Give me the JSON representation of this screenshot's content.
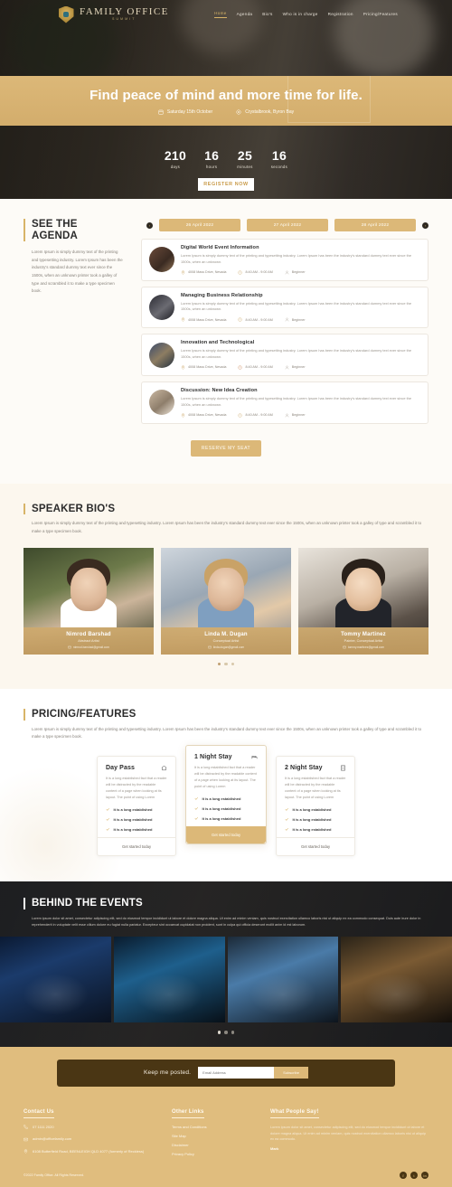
{
  "header": {
    "brand_name": "FAMILY OFFICE",
    "brand_sub": "SUMMIT",
    "nav": [
      {
        "label": "Home",
        "active": true
      },
      {
        "label": "Agenda",
        "active": false
      },
      {
        "label": "Bio's",
        "active": false
      },
      {
        "label": "Who is in charge",
        "active": false
      },
      {
        "label": "Registration",
        "active": false
      },
      {
        "label": "Pricing/Features",
        "active": false
      }
    ]
  },
  "hero": {
    "title": "Find peace of mind and more time for life.",
    "date": "Saturday 15th October",
    "location": "Crystalbrook, Byron Bay",
    "countdown": [
      {
        "value": "210",
        "label": "days"
      },
      {
        "value": "16",
        "label": "hours"
      },
      {
        "value": "25",
        "label": "minutes"
      },
      {
        "value": "16",
        "label": "seconds"
      }
    ],
    "register_label": "REGISTER NOW"
  },
  "agenda": {
    "title": "SEE THE AGENDA",
    "intro": "Lorem Ipsum is simply dummy text of the printing and typesetting industry. Lorem Ipsum has been the industry's standard dummy text ever since the 1500s, when an unknown printer took a galley of type and scrambled it to make a type specimen book.",
    "tabs": [
      "26 April 2022",
      "27 April 2022",
      "28 April 2022"
    ],
    "prev_label": "‹",
    "next_label": "›",
    "sessions": [
      {
        "title": "Digital World Event Information",
        "desc": "Lorem Ipsum is simply dummy text of the printing and typesetting industry. Lorem Ipsum has been the industry's standard dummy text ever since the 1500s, when an unknown.",
        "location": "4008 Mass Drive, Nevada",
        "time": "8:40 AM - 9:00 AM",
        "level": "Beginner"
      },
      {
        "title": "Managing Business Relationship",
        "desc": "Lorem Ipsum is simply dummy text of the printing and typesetting industry. Lorem Ipsum has been the industry's standard dummy text ever since the 1500s, when an unknown.",
        "location": "4008 Mass Drive, Nevada",
        "time": "8:40 AM - 9:00 AM",
        "level": "Beginner"
      },
      {
        "title": "Innovation and Technological",
        "desc": "Lorem Ipsum is simply dummy text of the printing and typesetting industry. Lorem Ipsum has been the industry's standard dummy text ever since the 1500s, when an unknown.",
        "location": "4008 Mass Drive, Nevada",
        "time": "8:40 AM - 9:00 AM",
        "level": "Beginner"
      },
      {
        "title": "Discussion: New Idea Creation",
        "desc": "Lorem Ipsum is simply dummy text of the printing and typesetting industry. Lorem Ipsum has been the industry's standard dummy text ever since the 1500s, when an unknown.",
        "location": "4008 Mass Drive, Nevada",
        "time": "8:40 AM - 9:00 AM",
        "level": "Beginner"
      }
    ],
    "reserve_label": "RESERVE MY SEAT"
  },
  "speakers": {
    "title": "SPEAKER BIO'S",
    "intro": "Lorem Ipsum is simply dummy text of the printing and typesetting industry. Lorem Ipsum has been the industry's standard dummy text ever since the 1500s, when an unknown printer took a galley of type and scrambled it to make a type specimen book.",
    "cards": [
      {
        "name": "Nimrod Barshad",
        "role": "Abstract Artist",
        "email": "nimrod.barshad@gmail.com"
      },
      {
        "name": "Linda M. Dugan",
        "role": "Conceptual Artist",
        "email": "linda.dugan@gmail.com"
      },
      {
        "name": "Tommy Martinez",
        "role": "Painter, Conceptual Artist",
        "email": "tommy.martinez@gmail.com"
      }
    ]
  },
  "pricing": {
    "title": "PRICING/FEATURES",
    "intro": "Lorem Ipsum is simply dummy text of the printing and typesetting industry. Lorem Ipsum has been the industry's standard dummy text ever since the 1500s, when an unknown printer took a galley of type and scrambled it to make a type specimen book.",
    "plans": [
      {
        "title": "Day Pass",
        "icon": "home-icon",
        "desc": "It is a long established fact that a reader will be distracted by the readable content of a page when looking at its layout. The point of using Lorem",
        "features": [
          "It is a long established",
          "It is a long established",
          "It is a long established"
        ],
        "cta": "Get started today",
        "featured": false
      },
      {
        "title": "1 Night Stay",
        "icon": "bed-icon",
        "desc": "It is a long established fact that a reader will be distracted by the readable content of a page when looking at its layout. The point of using Lorem",
        "features": [
          "It is a long established",
          "It is a long established",
          "It is a long established"
        ],
        "cta": "Get started today",
        "featured": true
      },
      {
        "title": "2 Night Stay",
        "icon": "building-icon",
        "desc": "It is a long established fact that a reader will be distracted by the readable content of a page when looking at its layout. The point of using Lorem",
        "features": [
          "It is a long established",
          "It is a long established",
          "It is a long established"
        ],
        "cta": "Get started today",
        "featured": false
      }
    ]
  },
  "behind": {
    "title": "BEHIND THE EVENTS",
    "body": "Lorem ipsum dolor sit amet, consectetur adipiscing elit, sed do eiusmod tempor incididunt ut labore et dolore magna aliqua. Ut enim ad minim veniam, quis nostrud exercitation ullamco laboris nisi ut aliquip ex ea commodo consequat. Duis aute irure dolor in reprehenderit in voluptate velit esse cillum dolore eu fugiat nulla pariatur. Excepteur sint occaecat cupidatat non proident, sunt in culpa qui officia deserunt mollit anim id est laborum."
  },
  "newsletter": {
    "text": "Keep me posted.",
    "placeholder": "Email Address",
    "button": "Subscribe"
  },
  "footer": {
    "contact_title": "Contact Us",
    "phone": "07 1111 2020",
    "email": "admin@officefamily.com",
    "address": "6108 Butterfield Road, BEENLEIGH QLD 4077 (formerly of Reckless)",
    "links_title": "Other Links",
    "links": [
      "Terms and Conditions",
      "Site Map",
      "Disclaimer",
      "Privacy Policy"
    ],
    "quote_title": "What People Say!",
    "quote": "Lorem ipsum dolor sit amet, consectetur adipiscing elit, sed do eiusmod tempor incididunt ut labore et dolore magna aliqua. Ut enim ad minim veniam, quis nostrud exercitation ullamco laboris nisi ut aliquip ex ea commodo.",
    "quote_name": "Mark",
    "copyright": "©2022 Family Office. All Rights Reserved.",
    "socials": [
      "f",
      "t",
      "in"
    ]
  },
  "colors": {
    "gold": "#dcb878",
    "dark_brown": "#4a3614",
    "cream": "#fdfbf7"
  }
}
